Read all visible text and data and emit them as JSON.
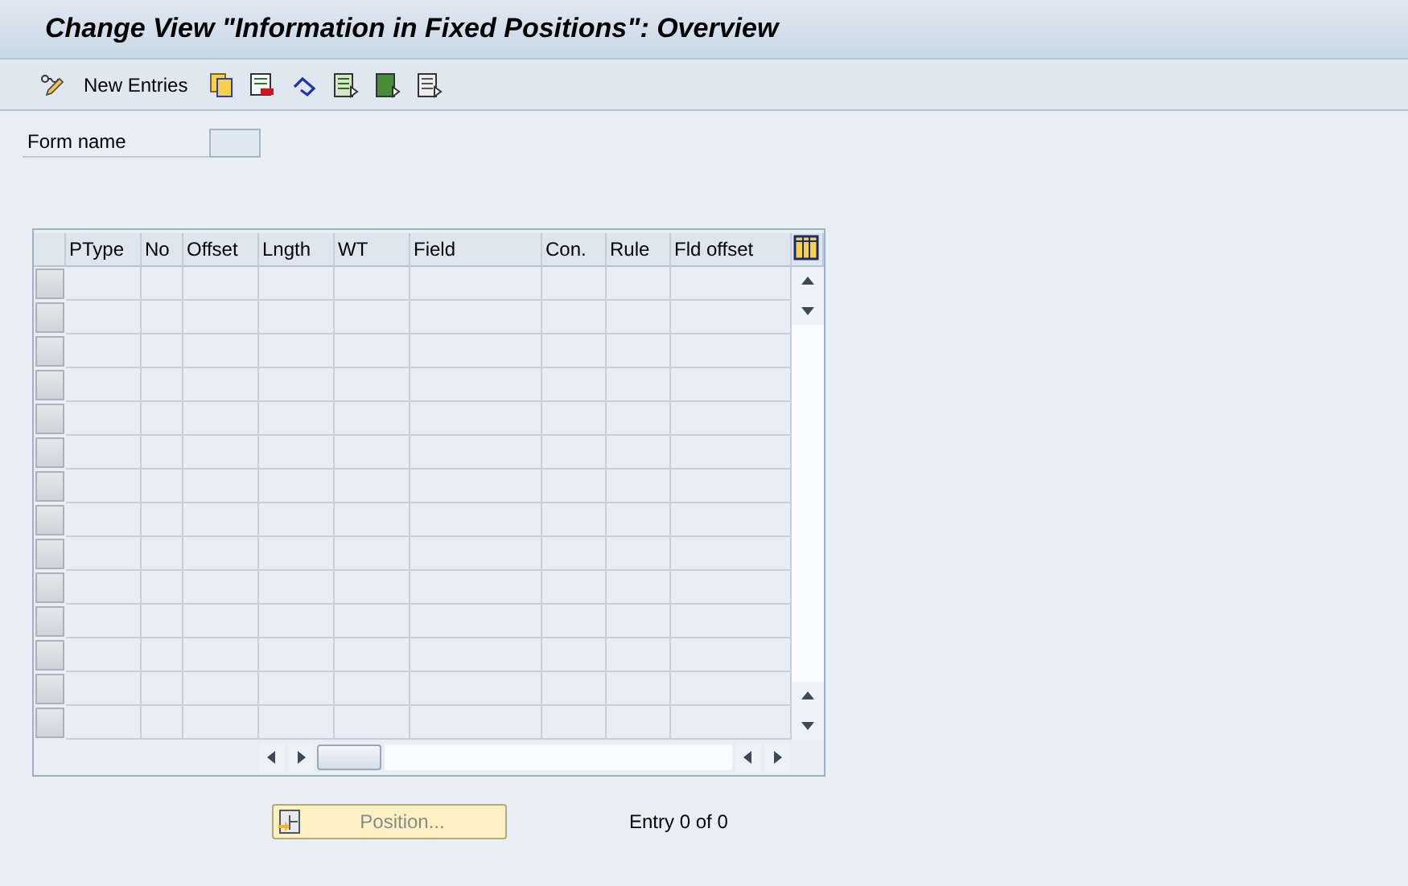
{
  "window": {
    "title": "Change View \"Information in Fixed Positions\": Overview"
  },
  "toolbar": {
    "new_entries": "New Entries"
  },
  "form": {
    "label": "Form name"
  },
  "table": {
    "columns": [
      "PType",
      "No",
      "Offset",
      "Lngth",
      "WT",
      "Field",
      "Con.",
      "Rule",
      "Fld offset"
    ]
  },
  "position_button": {
    "label": "Position...",
    "disabled": true
  },
  "entry_info": "Entry 0 of 0"
}
